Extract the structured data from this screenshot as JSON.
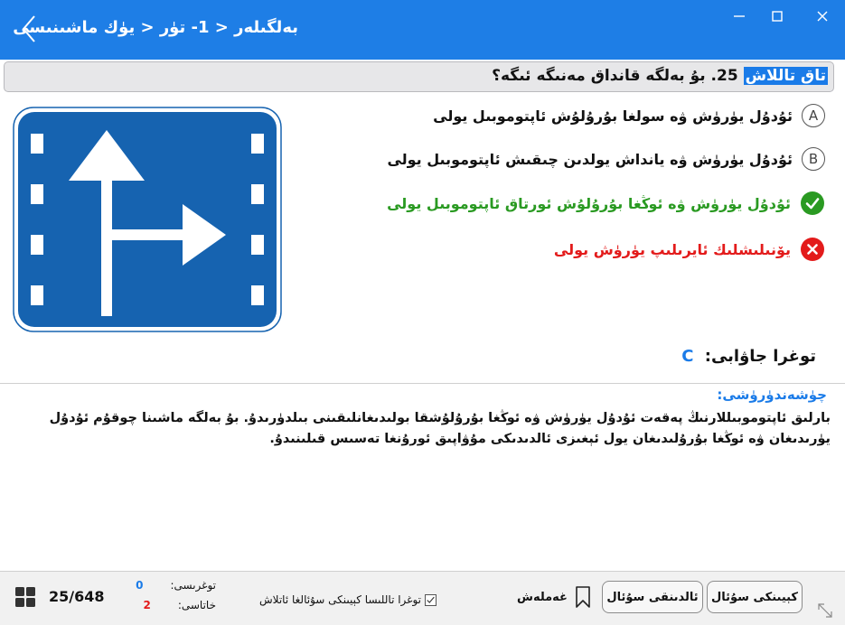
{
  "window": {
    "title": "بەلگىلەر < 1- تۈر < يۈك ماشىنىسى"
  },
  "question": {
    "tag": "تاق تاللاش",
    "number": "25.",
    "text": "بۇ بەلگە قانداق مەنىگە ئىگە؟"
  },
  "options": [
    {
      "letter": "A",
      "text": "ئۇدۇل يۈرۈش ۋە سولغا بۇرۇلۇش ئاپتوموبىل يولى",
      "state": "normal"
    },
    {
      "letter": "B",
      "text": "ئۇدۇل يۈرۈش ۋە يانداش يولدىن چىقىش ئاپتوموبىل يولى",
      "state": "normal"
    },
    {
      "letter": "C",
      "text": "ئۇدۇل يۈرۈش ۋە ئوڭغا بۇرۇلۇش ئورتاق ئاپتوموبىل يولى",
      "state": "correct"
    },
    {
      "letter": "D",
      "text": "يۆنىلىشلىك ئايرىلىپ يۈرۈش يولى",
      "state": "wrong"
    }
  ],
  "answer": {
    "label": "توغرا جاۋابى:",
    "letter": "C"
  },
  "explanation": {
    "title": "چۈشەندۈرۈشى:",
    "text": "بارلىق ئاپتوموبىللارنىڭ پەقەت ئۇدۇل يۈرۈش ۋە ئوڭغا بۇرۇلۇشقا بولىدىغانلىقىنى بىلدۈرىدۇ. بۇ بەلگە ماشىنا چوقۇم ئۇدۇل يۈرىدىغان ۋە ئوڭغا بۇرۇلىدىغان يول ئېغىزى ئالدىدىكى مۇۋاپىق ئورۇنغا تەسىس قىلىنىدۇ."
  },
  "footer": {
    "progress": "25/648",
    "correct_label": "توغرىسى:",
    "correct_count": "0",
    "wrong_label": "خاتاسى:",
    "wrong_count": "2",
    "auto_next_label": "توغرا تاللىسا كېيىنكى سۇئالغا ئاتلاش",
    "bookmark_label": "غەملەش",
    "prev_label": "ئالدىنقى سۇئال",
    "next_label": "كېيىنكى سۇئال"
  },
  "colors": {
    "titlebar": "#1e7ee6",
    "sign_blue": "#1663b0",
    "correct": "#2a9a22",
    "wrong": "#e31b1b",
    "accent": "#1a7be8"
  },
  "icons": {
    "back": "chevron-left-icon",
    "minimize": "minimize-icon",
    "maximize": "maximize-icon",
    "close": "close-icon",
    "correct": "check-circle-icon",
    "wrong": "x-circle-icon",
    "grid": "grid-icon",
    "bookmark": "bookmark-icon",
    "resize": "resize-icon"
  }
}
